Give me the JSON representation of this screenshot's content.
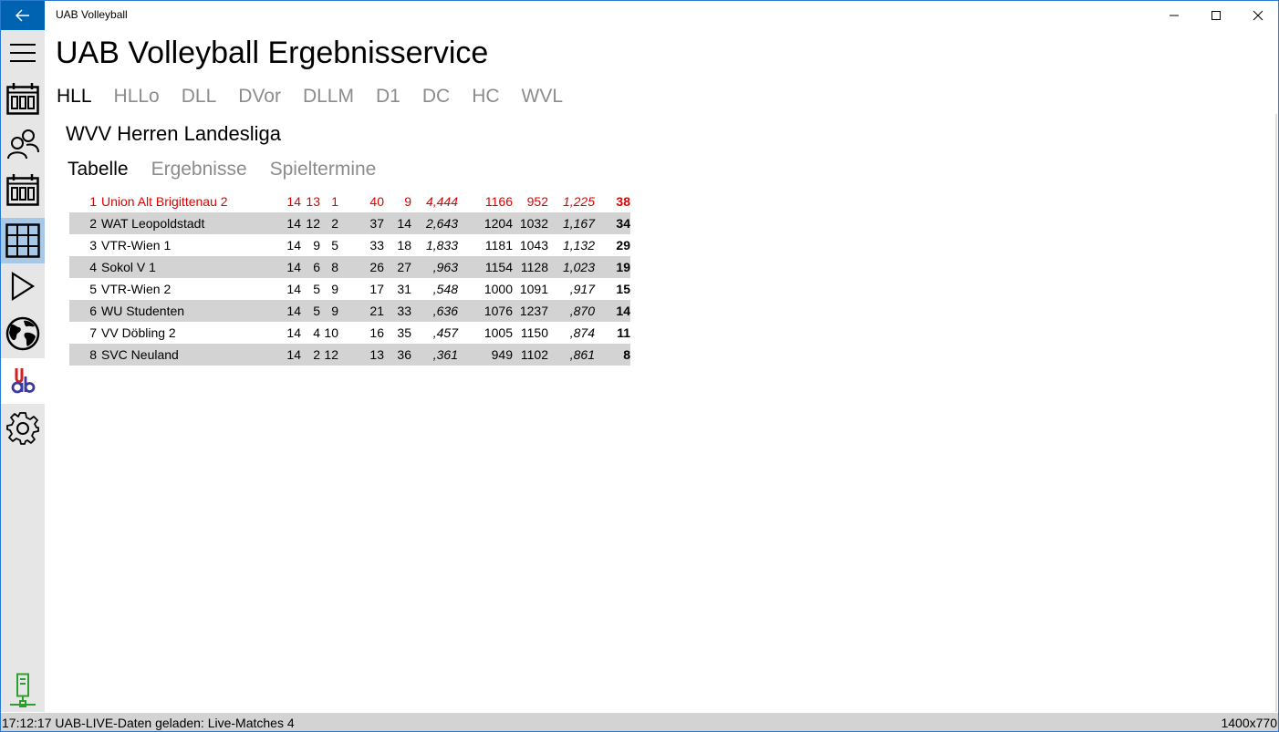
{
  "window": {
    "title": "UAB Volleyball"
  },
  "header": {
    "title": "UAB Volleyball Ergebnisservice",
    "league_tabs": [
      "HLL",
      "HLLo",
      "DLL",
      "DVor",
      "DLLM",
      "D1",
      "DC",
      "HC",
      "WVL"
    ],
    "active_league_tab": "HLL"
  },
  "sidebar": {
    "items": [
      {
        "icon": "hamburger-menu-icon"
      },
      {
        "icon": "calendar-icon"
      },
      {
        "icon": "people-icon"
      },
      {
        "icon": "calendar-icon"
      },
      {
        "icon": "grid-table-icon",
        "selected": true
      },
      {
        "icon": "play-icon"
      },
      {
        "icon": "globe-icon"
      },
      {
        "icon": "uab-logo"
      },
      {
        "icon": "gear-icon"
      }
    ],
    "status_icon": "server-network-icon"
  },
  "main": {
    "league_name": "WVV Herren Landesliga",
    "sub_tabs": [
      "Tabelle",
      "Ergebnisse",
      "Spieltermine"
    ],
    "active_sub_tab": "Tabelle",
    "standings": [
      {
        "rank": "1",
        "team": "Union Alt Brigittenau 2",
        "played": "14",
        "won": "13",
        "lost": "1",
        "sets_won": "40",
        "sets_lost": "9",
        "set_quotient": "4,444",
        "balls_won": "1166",
        "balls_lost": "952",
        "ball_quotient": "1,225",
        "points": "38"
      },
      {
        "rank": "2",
        "team": "WAT Leopoldstadt",
        "played": "14",
        "won": "12",
        "lost": "2",
        "sets_won": "37",
        "sets_lost": "14",
        "set_quotient": "2,643",
        "balls_won": "1204",
        "balls_lost": "1032",
        "ball_quotient": "1,167",
        "points": "34"
      },
      {
        "rank": "3",
        "team": "VTR-Wien 1",
        "played": "14",
        "won": "9",
        "lost": "5",
        "sets_won": "33",
        "sets_lost": "18",
        "set_quotient": "1,833",
        "balls_won": "1181",
        "balls_lost": "1043",
        "ball_quotient": "1,132",
        "points": "29"
      },
      {
        "rank": "4",
        "team": "Sokol V 1",
        "played": "14",
        "won": "6",
        "lost": "8",
        "sets_won": "26",
        "sets_lost": "27",
        "set_quotient": ",963",
        "balls_won": "1154",
        "balls_lost": "1128",
        "ball_quotient": "1,023",
        "points": "19"
      },
      {
        "rank": "5",
        "team": "VTR-Wien 2",
        "played": "14",
        "won": "5",
        "lost": "9",
        "sets_won": "17",
        "sets_lost": "31",
        "set_quotient": ",548",
        "balls_won": "1000",
        "balls_lost": "1091",
        "ball_quotient": ",917",
        "points": "15"
      },
      {
        "rank": "6",
        "team": "WU Studenten",
        "played": "14",
        "won": "5",
        "lost": "9",
        "sets_won": "21",
        "sets_lost": "33",
        "set_quotient": ",636",
        "balls_won": "1076",
        "balls_lost": "1237",
        "ball_quotient": ",870",
        "points": "14"
      },
      {
        "rank": "7",
        "team": "VV Döbling 2",
        "played": "14",
        "won": "4",
        "lost": "10",
        "sets_won": "16",
        "sets_lost": "35",
        "set_quotient": ",457",
        "balls_won": "1005",
        "balls_lost": "1150",
        "ball_quotient": ",874",
        "points": "11"
      },
      {
        "rank": "8",
        "team": "SVC Neuland",
        "played": "14",
        "won": "2",
        "lost": "12",
        "sets_won": "13",
        "sets_lost": "36",
        "set_quotient": ",361",
        "balls_won": "949",
        "balls_lost": "1102",
        "ball_quotient": ",861",
        "points": "8"
      }
    ]
  },
  "statusbar": {
    "message": "17:12:17 UAB-LIVE-Daten geladen: Live-Matches 4",
    "window_size": "1400x770"
  },
  "colors": {
    "accent": "#0063b1",
    "leader_text": "#e00000",
    "alt_row": "#d3d3d3",
    "sidebar_bg": "#e6e6e6",
    "sidebar_selected": "#a8c8e8",
    "status_icon": "#2e9e2e"
  }
}
